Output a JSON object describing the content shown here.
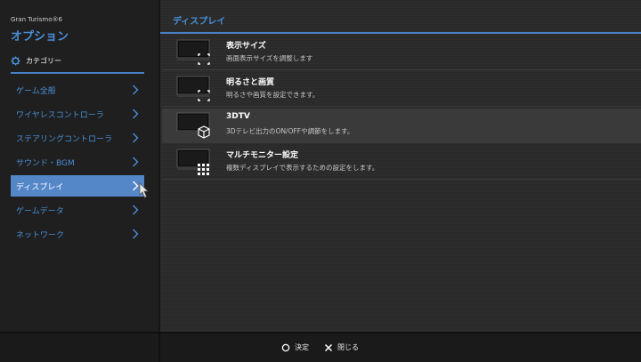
{
  "sidebar": {
    "game_name": "Gran Turismo®6",
    "title": "オプション",
    "category_label": "カテゴリー",
    "items": [
      {
        "label": "ゲーム全般"
      },
      {
        "label": "ワイヤレスコントローラ"
      },
      {
        "label": "ステアリングコントローラ"
      },
      {
        "label": "サウンド・BGM"
      },
      {
        "label": "ディスプレイ",
        "selected": true
      },
      {
        "label": "ゲームデータ"
      },
      {
        "label": "ネットワーク"
      }
    ]
  },
  "main": {
    "title": "ディスプレイ",
    "options": [
      {
        "title": "表示サイズ",
        "desc": "画面表示サイズを調整します",
        "icon": "screen-size-icon"
      },
      {
        "title": "明るさと画質",
        "desc": "明るさや画質を設定できます。",
        "icon": "brightness-icon"
      },
      {
        "title": "3DTV",
        "desc": "3Dテレビ出力のON/OFFや調節をします。",
        "icon": "3d-cube-icon",
        "selected": true
      },
      {
        "title": "マルチモニター設定",
        "desc": "複数ディスプレイで表示するための設定をします。",
        "icon": "multi-monitor-icon"
      }
    ]
  },
  "footer": {
    "confirm_label": "決定",
    "close_label": "閉じる"
  },
  "colors": {
    "accent": "#4a90d9",
    "selected_bg": "#5487c8"
  }
}
